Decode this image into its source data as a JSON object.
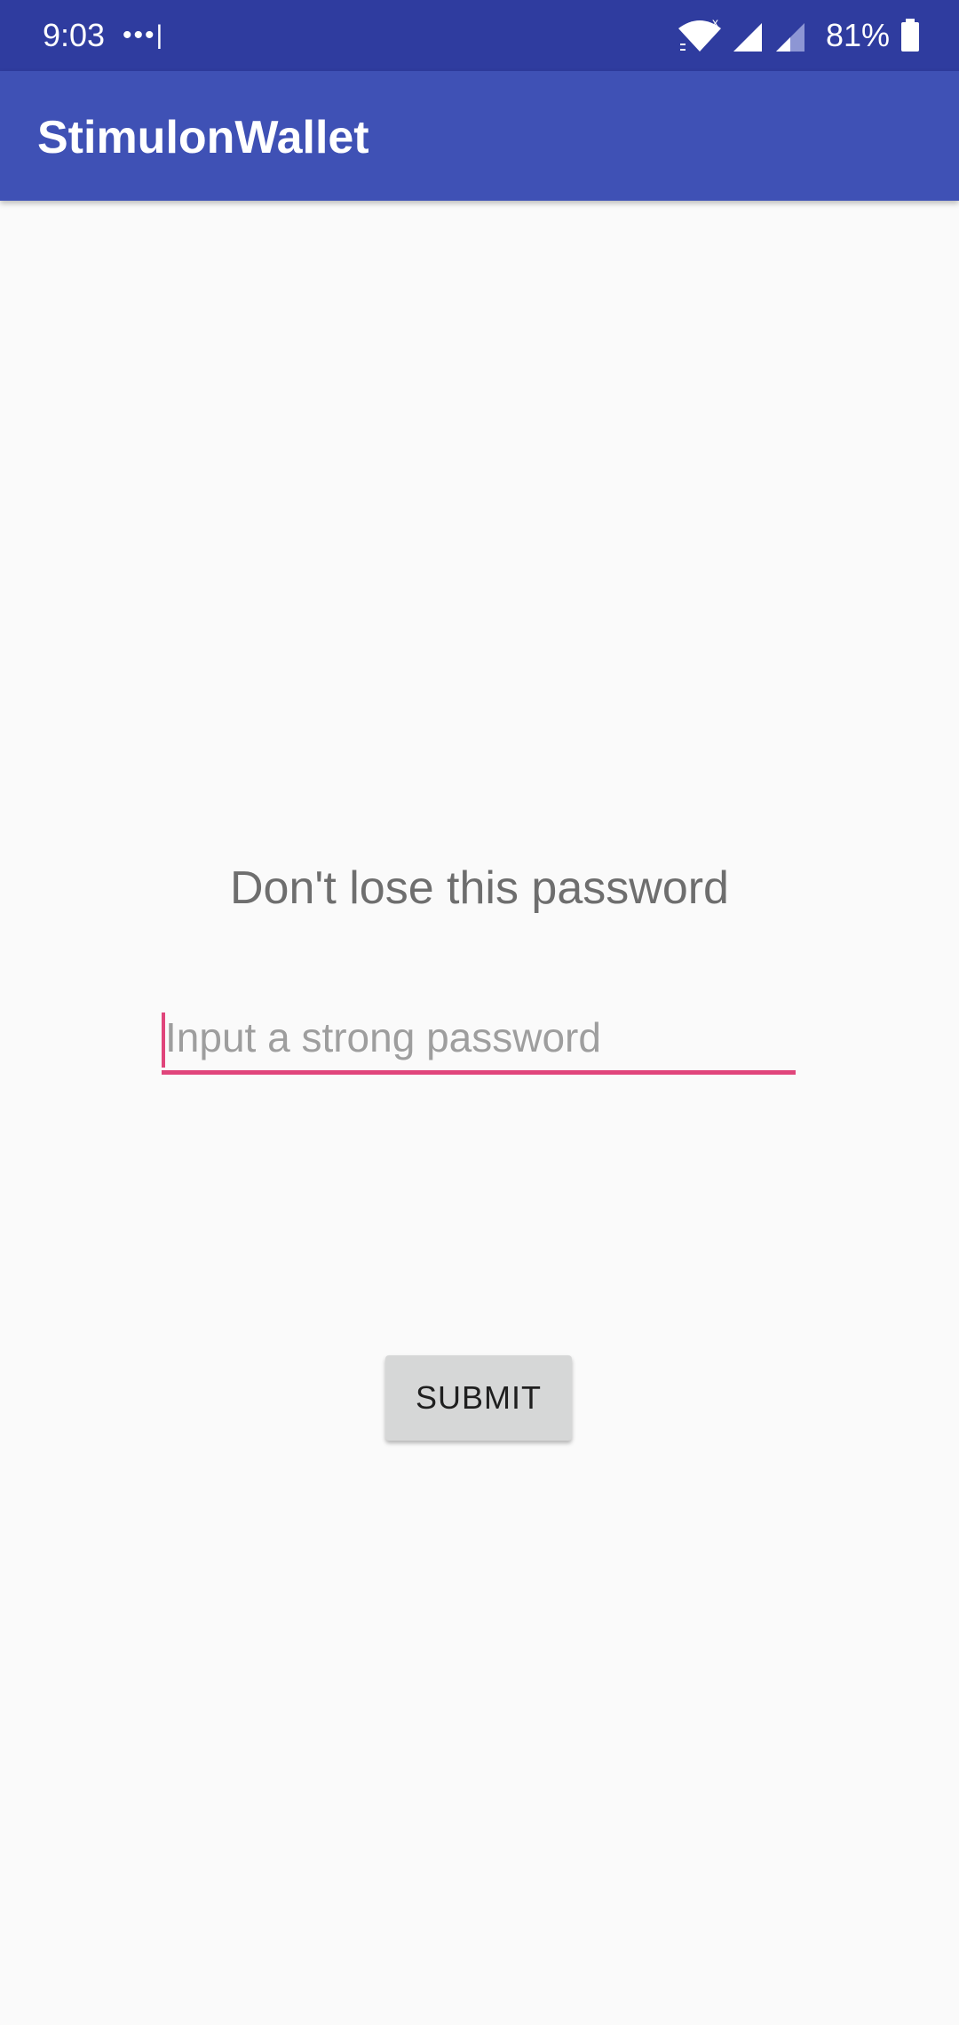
{
  "status_bar": {
    "time": "9:03",
    "dots": "•••|",
    "battery_percent": "81%",
    "icons": [
      "wifi-icon",
      "cellular-signal-icon",
      "cellular-signal-icon",
      "battery-icon"
    ]
  },
  "app_bar": {
    "title": "StimulonWallet"
  },
  "main": {
    "heading": "Don't lose this password",
    "password_placeholder": "Input a strong password",
    "password_value": "",
    "submit_label": "SUBMIT"
  },
  "colors": {
    "status_bar": "#2f3c9f",
    "app_bar": "#3f51b5",
    "accent": "#e0457b",
    "background": "#fafafa",
    "button": "#d6d7d7"
  }
}
